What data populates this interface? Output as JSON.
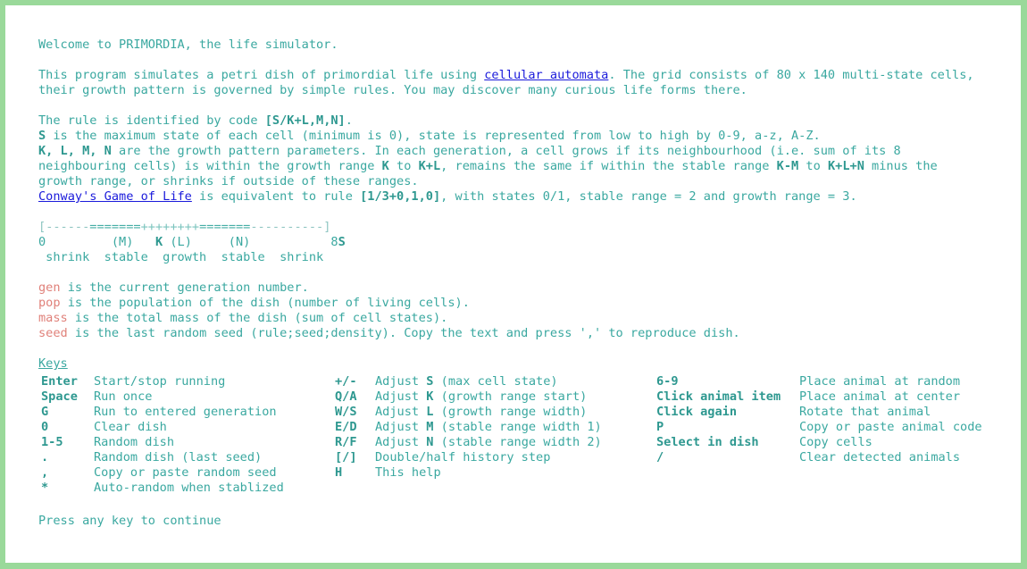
{
  "welcome": "Welcome to PRIMORDIA, the life simulator.",
  "intro": {
    "p1_before_link": "This program simulates a petri dish of primordial life using ",
    "link_cellular": "cellular automata",
    "p1_after_link": ". The grid consists of 80 x 140 multi-state cells,",
    "p2": "their growth pattern is governed by simple rules. You may discover many curious life forms there."
  },
  "rule": {
    "l1_text": "The rule is identified by code ",
    "l1_code": "[S/K+L,M,N]",
    "l1_end": ".",
    "l2_s": "S",
    "l2_text": " is the maximum state of each cell (minimum is 0), state is represented from low to high by 0-9, a-z, A-Z.",
    "l3_klmn": "K, L, M, N",
    "l3_text": " are the growth pattern parameters. In each generation, a cell grows if its neighbourhood (i.e. sum of its 8",
    "l4_a": "neighbouring cells) is within the growth range ",
    "l4_k": "K",
    "l4_b": " to ",
    "l4_kl": "K+L",
    "l4_c": ", remains the same if within the stable range ",
    "l4_km": "K-M",
    "l4_d": " to ",
    "l4_kln": "K+L+N",
    "l4_e": " minus the",
    "l5": "growth range, or shrinks if outside of these ranges.",
    "l6_link": "Conway's Game of Life",
    "l6_a": " is equivalent to rule ",
    "l6_code": "[1/3+0,1,0]",
    "l6_b": ", with states 0/1, stable range = 2 and growth range = 3."
  },
  "diagram": {
    "open": "[",
    "d1": "------",
    "e1": "=======",
    "p": "++++++++",
    "e2": "=======",
    "d2": "----------",
    "close": "]",
    "labels_a": "0         (M)   ",
    "labels_k": "K",
    "labels_b": " (L)     (N)           8",
    "labels_s": "S",
    "zones": " shrink  stable  growth  stable  shrink"
  },
  "stats": [
    {
      "name": "gen",
      "text": " is the current generation number."
    },
    {
      "name": "pop",
      "text": " is the population of the dish (number of living cells)."
    },
    {
      "name": "mass",
      "text": " is the total mass of the dish (sum of cell states)."
    },
    {
      "name": "seed",
      "text": " is the last random seed (rule;seed;density). Copy the text and press ',' to reproduce dish."
    }
  ],
  "keys_title": "Keys",
  "keys": {
    "col1": [
      {
        "key": "Enter",
        "desc": "Start/stop running"
      },
      {
        "key": "Space",
        "desc": "Run once"
      },
      {
        "key": "G",
        "desc": "Run to entered generation"
      },
      {
        "key": "0",
        "desc": "Clear dish"
      },
      {
        "key": "1-5",
        "desc": "Random dish"
      },
      {
        "key": ".",
        "desc": "Random dish (last seed)"
      },
      {
        "key": ",",
        "desc": "Copy or paste random seed"
      },
      {
        "key": "*",
        "desc": "Auto-random when stablized"
      }
    ],
    "col2": [
      {
        "key": "+/-",
        "desc_a": "Adjust ",
        "param": "S",
        "desc_b": " (max cell state)"
      },
      {
        "key": "Q/A",
        "desc_a": "Adjust ",
        "param": "K",
        "desc_b": " (growth range start)"
      },
      {
        "key": "W/S",
        "desc_a": "Adjust ",
        "param": "L",
        "desc_b": " (growth range width)"
      },
      {
        "key": "E/D",
        "desc_a": "Adjust ",
        "param": "M",
        "desc_b": " (stable range width 1)"
      },
      {
        "key": "R/F",
        "desc_a": "Adjust ",
        "param": "N",
        "desc_b": " (stable range width 2)"
      },
      {
        "key": "[/]",
        "desc_a": "Double/half history step",
        "param": "",
        "desc_b": ""
      },
      {
        "key": "H",
        "desc_a": "This help",
        "param": "",
        "desc_b": ""
      }
    ],
    "col3": [
      {
        "key": "6-9",
        "desc": "Place animal at random"
      },
      {
        "key": "Click animal item",
        "desc": "Place animal at center"
      },
      {
        "key": "Click again",
        "desc": "Rotate that animal"
      },
      {
        "key": "P",
        "desc": "Copy or paste animal code"
      },
      {
        "key": "Select in dish",
        "desc": "Copy cells"
      },
      {
        "key": "/",
        "desc": "Clear detected animals"
      }
    ]
  },
  "footer": "Press any key to continue"
}
